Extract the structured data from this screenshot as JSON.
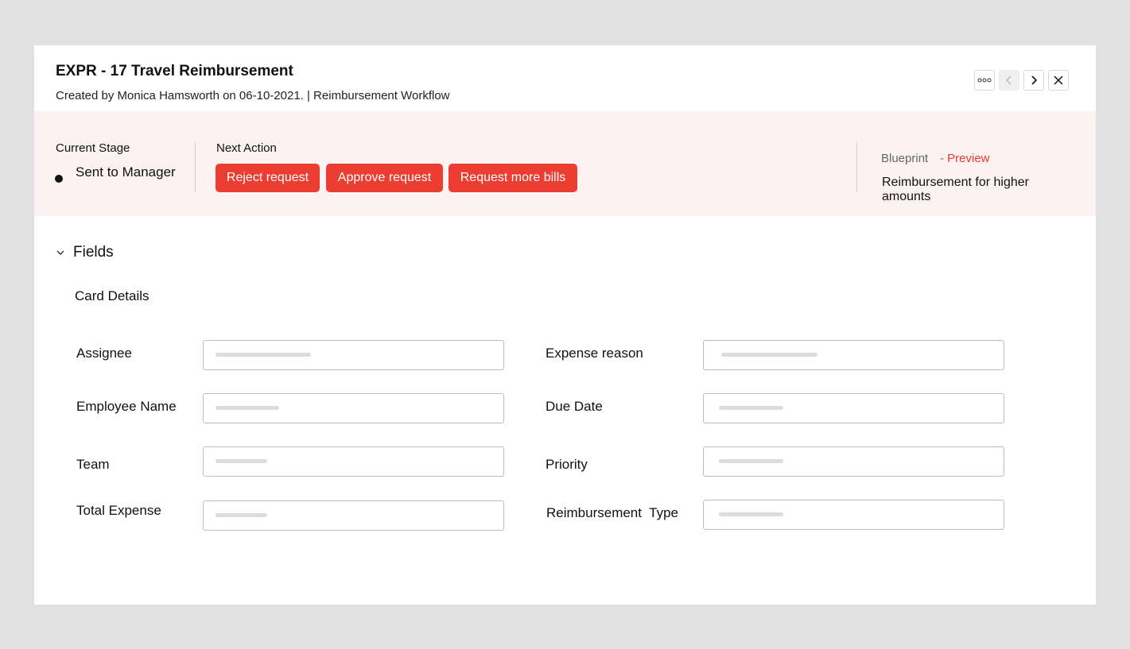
{
  "header": {
    "title": "EXPR - 17 Travel Reimbursement",
    "subtitle": "Created by Monica Hamsworth on 06-10-2021. | Reimbursement Workflow"
  },
  "toolbar": {
    "more_icon": "more-dots-icon",
    "prev_icon": "chevron-left-icon",
    "next_icon": "chevron-right-icon",
    "close_icon": "close-icon"
  },
  "stage": {
    "current_label": "Current Stage",
    "current_value": "Sent to Manager",
    "next_label": "Next Action",
    "actions": [
      "Reject request",
      "Approve request",
      "Request more bills"
    ],
    "blueprint_label": "Blueprint",
    "preview_label": "- Preview",
    "blueprint_name": "Reimbursement for higher amounts"
  },
  "fields": {
    "section_label": "Fields",
    "card_title": "Card Details",
    "left": [
      {
        "label": "Assignee",
        "value": ""
      },
      {
        "label": "Employee Name",
        "value": ""
      },
      {
        "label": "Team",
        "value": ""
      },
      {
        "label": "Total Expense",
        "value": ""
      }
    ],
    "right": [
      {
        "label": "Expense reason",
        "value": ""
      },
      {
        "label": "Due Date",
        "value": ""
      },
      {
        "label": "Priority",
        "value": ""
      },
      {
        "label": "Reimbursement  Type",
        "value": ""
      }
    ]
  },
  "colors": {
    "accent": "#ec3d32",
    "stage_band": "#fdf2f2",
    "preview": "#e53a2f"
  }
}
